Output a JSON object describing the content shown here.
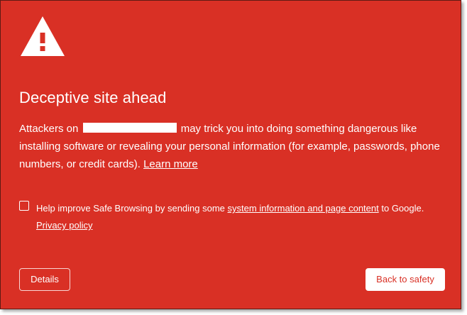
{
  "page": {
    "title": "Deceptive site ahead",
    "body_prefix": "Attackers on",
    "body_suffix": "may trick you into doing something dangerous like installing software or revealing your personal information (for example, passwords, phone numbers, or credit cards).",
    "learn_more": "Learn more"
  },
  "opt_in": {
    "checked": false,
    "text_prefix": "Help improve Safe Browsing by sending some",
    "link_text": "system information and page content",
    "text_suffix": "to Google.",
    "privacy_link": "Privacy policy"
  },
  "buttons": {
    "details_label": "Details",
    "back_label": "Back to safety"
  },
  "icons": {
    "warning": "warning-triangle-icon"
  },
  "colors": {
    "background": "#d93025",
    "text": "#ffffff",
    "primary_button_text": "#d93025"
  }
}
